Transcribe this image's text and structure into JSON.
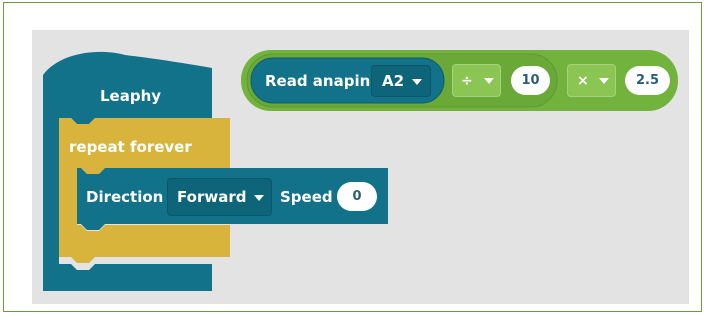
{
  "colors": {
    "frame_border": "#6e9a3f",
    "workspace_bg": "#e3e3e3",
    "hat_block": "#11728a",
    "loop_block": "#d8b43d",
    "motor_block": "#11728a",
    "math_block": "#72b33d",
    "sensor_block": "#11728a"
  },
  "hat_block": {
    "label": "Leaphy"
  },
  "loop_block": {
    "label": "repeat forever"
  },
  "motor_block": {
    "label": "Direction",
    "direction_value": "Forward",
    "speed_label": "Speed",
    "speed_value": "0"
  },
  "expression": {
    "sensor_label": "Read anapin",
    "pin_value": "A2",
    "divide_operator": "÷",
    "divide_value": "10",
    "multiply_operator": "×",
    "multiply_value": "2.5"
  },
  "icons": [
    "dropdown-caret-icon"
  ]
}
